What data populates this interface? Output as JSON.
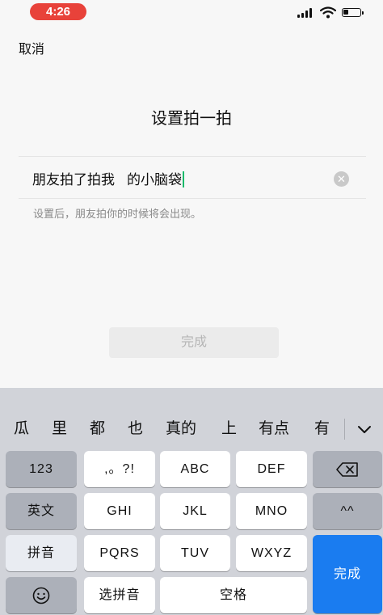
{
  "status": {
    "time": "4:26"
  },
  "nav": {
    "cancel": "取消"
  },
  "page": {
    "title": "设置拍一拍",
    "field_prefix": "朋友拍了拍我",
    "field_value": "的小脑袋",
    "hint": "设置后，朋友拍你的时候将会出现。",
    "done": "完成"
  },
  "keyboard": {
    "candidates": [
      "瓜",
      "里",
      "都",
      "也",
      "真的",
      "上",
      "有点",
      "有"
    ],
    "row1": [
      "123",
      ",。?!",
      "ABC",
      "DEF"
    ],
    "row2": [
      "英文",
      "GHI",
      "JKL",
      "MNO",
      "^^"
    ],
    "row3": [
      "拼音",
      "PQRS",
      "TUV",
      "WXYZ"
    ],
    "row4": [
      "选拼音",
      "空格"
    ],
    "done": "完成"
  },
  "colors": {
    "time_pill": "#e8423a",
    "accent_blue": "#1a7cf0",
    "caret": "#15b96a"
  }
}
